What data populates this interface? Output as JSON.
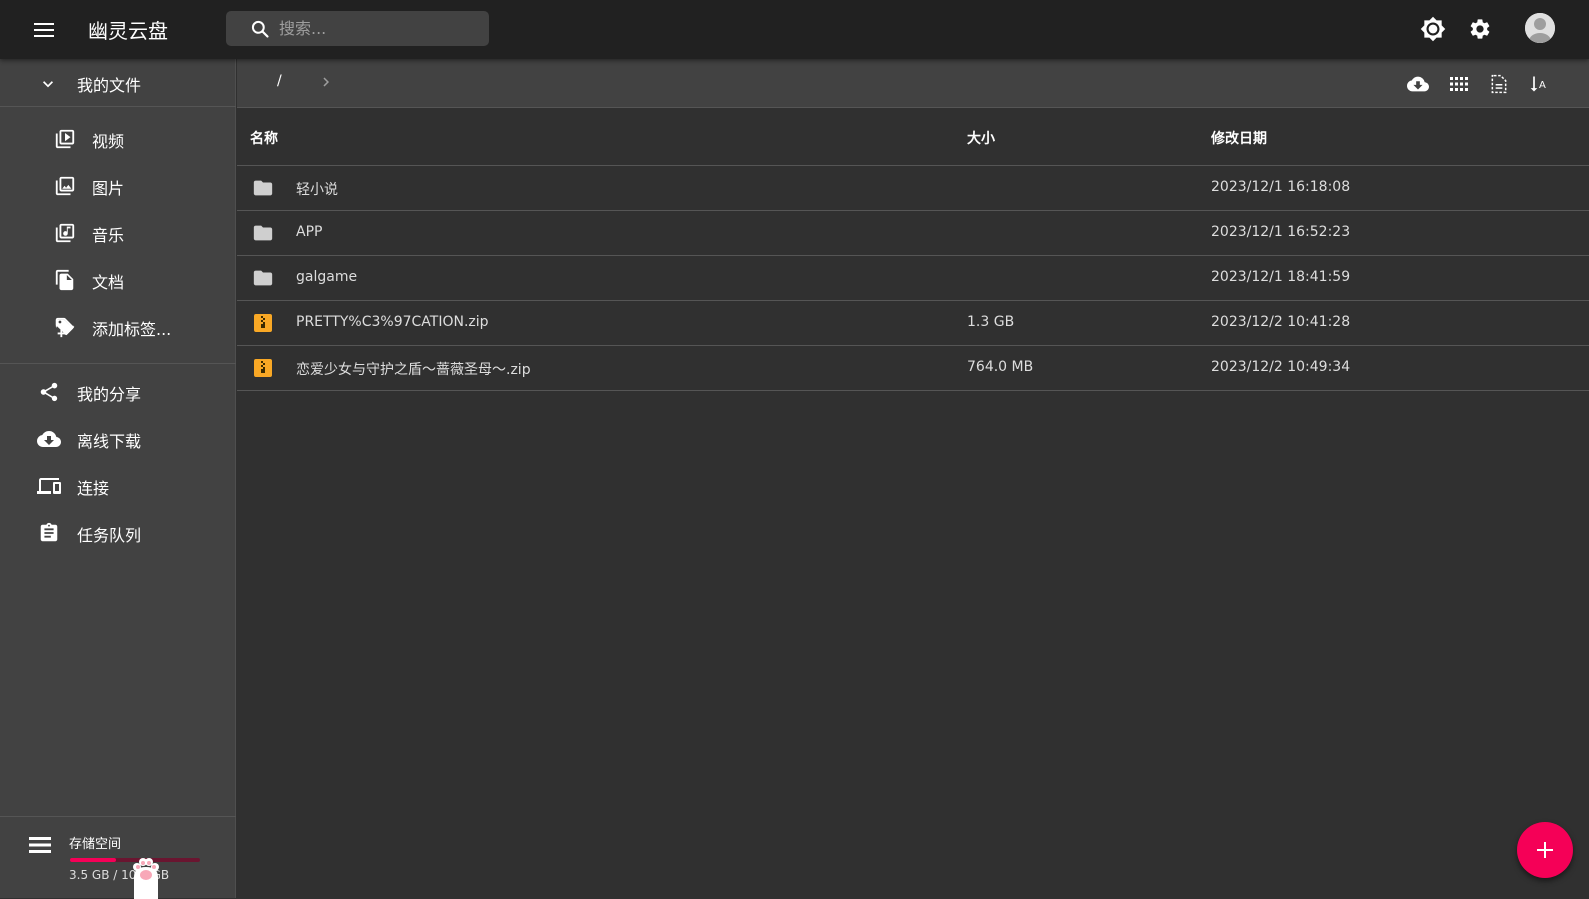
{
  "app": {
    "title": "幽灵云盘"
  },
  "search": {
    "placeholder": "搜索..."
  },
  "topbar": {
    "icons": [
      "brightness-icon",
      "settings-icon",
      "account-avatar"
    ]
  },
  "sidebar": {
    "my_files": "我的文件",
    "file_types": [
      {
        "label": "视频",
        "icon": "video-library-icon"
      },
      {
        "label": "图片",
        "icon": "image-library-icon"
      },
      {
        "label": "音乐",
        "icon": "music-library-icon"
      },
      {
        "label": "文档",
        "icon": "document-icon"
      },
      {
        "label": "添加标签...",
        "icon": "add-tag-icon"
      }
    ],
    "items": [
      {
        "label": "我的分享",
        "icon": "share-icon"
      },
      {
        "label": "离线下载",
        "icon": "cloud-download-icon"
      },
      {
        "label": "连接",
        "icon": "devices-icon"
      },
      {
        "label": "任务队列",
        "icon": "clipboard-icon"
      }
    ],
    "storage": {
      "title": "存储空间",
      "usage": "3.5 GB / 10.0 GB",
      "used_fraction": 0.35
    }
  },
  "breadcrumb": {
    "root": "/"
  },
  "table": {
    "headers": {
      "name": "名称",
      "size": "大小",
      "modified": "修改日期"
    },
    "rows": [
      {
        "type": "folder",
        "name": "轻小说",
        "size": "",
        "modified": "2023/12/1 16:18:08"
      },
      {
        "type": "folder",
        "name": "APP",
        "size": "",
        "modified": "2023/12/1 16:52:23"
      },
      {
        "type": "folder",
        "name": "galgame",
        "size": "",
        "modified": "2023/12/1 18:41:59"
      },
      {
        "type": "zip",
        "name": "PRETTY%C3%97CATION.zip",
        "size": "1.3 GB",
        "modified": "2023/12/2 10:41:28"
      },
      {
        "type": "zip",
        "name": "恋爱少女与守护之盾～蔷薇圣母～.zip",
        "size": "764.0 MB",
        "modified": "2023/12/2 10:49:34"
      }
    ]
  },
  "colors": {
    "accent": "#f50057",
    "zip": "#f9a825",
    "appbar": "#212121",
    "panel": "#424242",
    "background": "#303030"
  }
}
